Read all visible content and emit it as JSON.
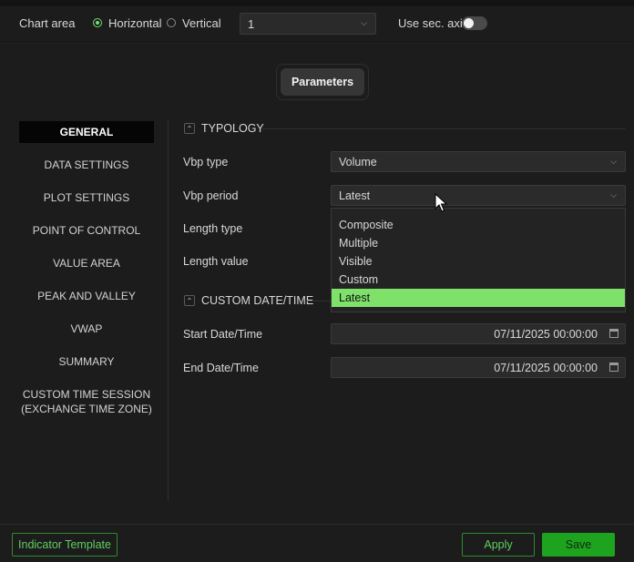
{
  "topbar": {
    "chart_area_label": "Chart area",
    "orientation_options": [
      {
        "label": "Horizontal",
        "selected": true
      },
      {
        "label": "Vertical",
        "selected": false
      }
    ],
    "chart_select_value": "1",
    "sec_axis_label": "Use sec. axis",
    "sec_axis_on": false
  },
  "parameters_button": "Parameters",
  "nav": {
    "items": [
      {
        "label": "GENERAL",
        "active": true
      },
      {
        "label": "DATA SETTINGS"
      },
      {
        "label": "PLOT SETTINGS"
      },
      {
        "label": "POINT OF CONTROL"
      },
      {
        "label": "VALUE AREA"
      },
      {
        "label": "PEAK AND VALLEY"
      },
      {
        "label": "VWAP"
      },
      {
        "label": "SUMMARY"
      },
      {
        "label": "CUSTOM TIME SESSION",
        "label2": "(EXCHANGE TIME ZONE)"
      }
    ]
  },
  "typology": {
    "title": "TYPOLOGY",
    "vbp_type_label": "Vbp type",
    "vbp_type_value": "Volume",
    "vbp_period_label": "Vbp period",
    "vbp_period_value": "Latest",
    "length_type_label": "Length type",
    "length_value_label": "Length value"
  },
  "period_dropdown": {
    "options": [
      "Composite",
      "Multiple",
      "Visible",
      "Custom",
      "Latest"
    ],
    "selected": "Latest"
  },
  "custom_datetime": {
    "title": "CUSTOM DATE/TIME",
    "start_label": "Start Date/Time",
    "start_value": "07/11/2025 00:00:00",
    "end_label": "End Date/Time",
    "end_value": "07/11/2025 00:00:00"
  },
  "footer": {
    "template_button": "Indicator Template",
    "apply_button": "Apply",
    "save_button": "Save"
  },
  "colors": {
    "accent_green": "#7ee16a",
    "save_green": "#1ea31e",
    "background": "#1c1c1c"
  },
  "icons": [
    "chevron-down-icon",
    "chevron-up-icon",
    "calendar-icon",
    "mouse-cursor-icon"
  ]
}
